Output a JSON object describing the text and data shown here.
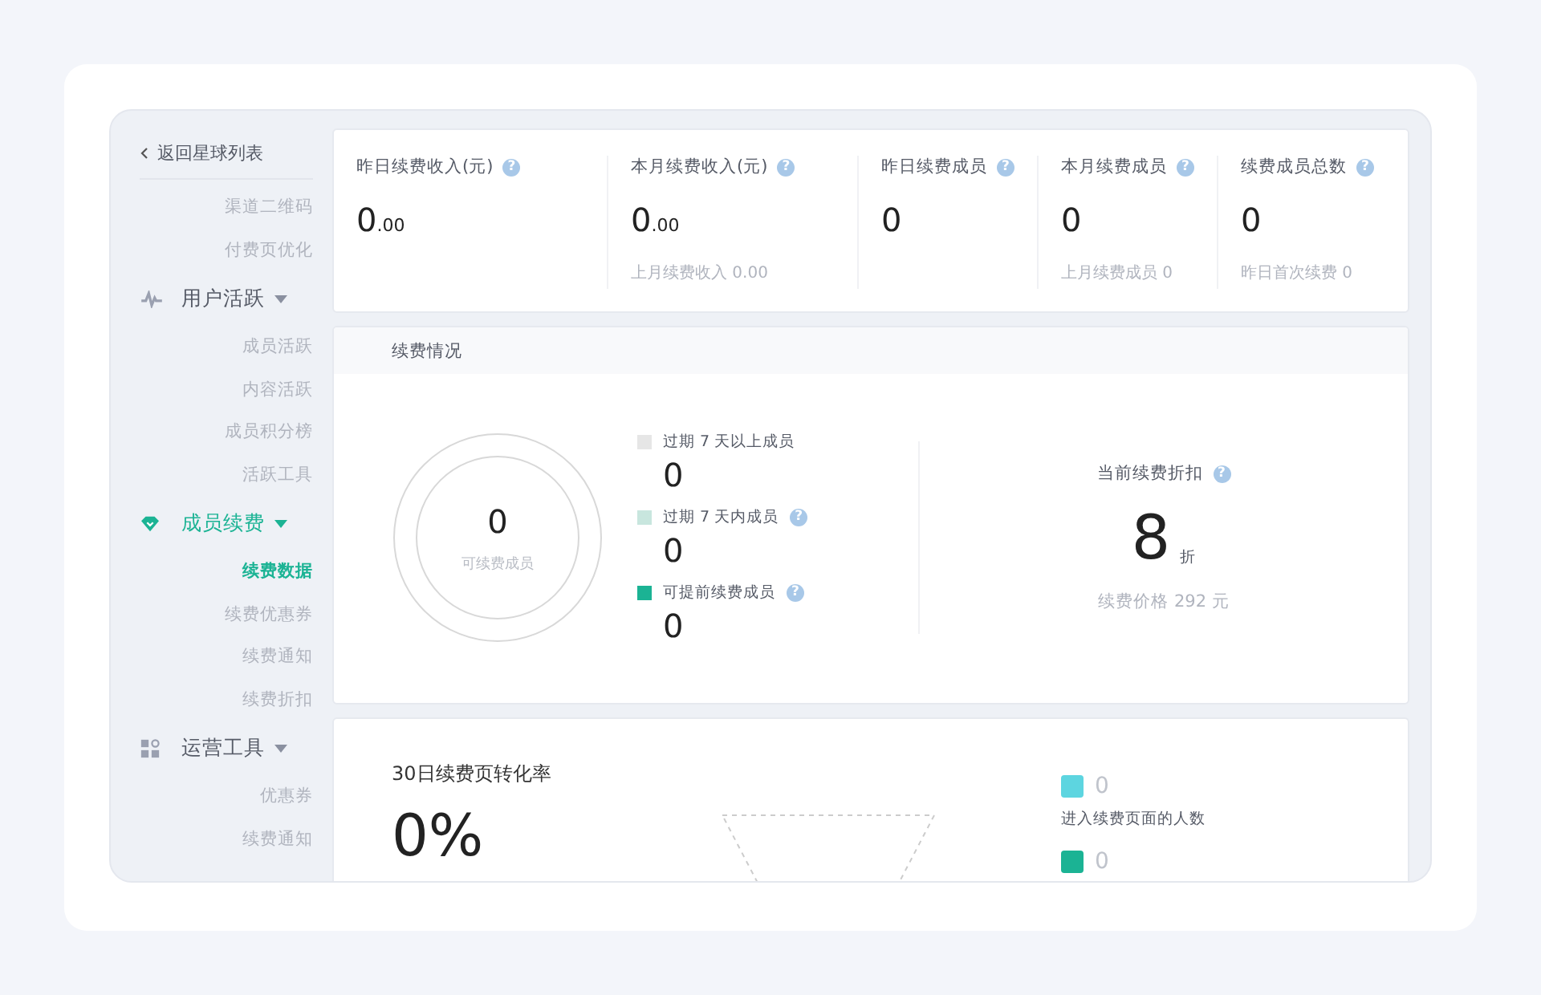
{
  "sidebar": {
    "back": "返回星球列表",
    "groups": [
      {
        "items": [
          {
            "label": "渠道二维码",
            "selected": false
          },
          {
            "label": "付费页优化",
            "selected": false
          }
        ]
      },
      {
        "title": "用户活跃",
        "selected": false,
        "expanded": true,
        "items": [
          {
            "label": "成员活跃",
            "selected": false
          },
          {
            "label": "内容活跃",
            "selected": false
          },
          {
            "label": "成员积分榜",
            "selected": false
          },
          {
            "label": "活跃工具",
            "selected": false
          }
        ]
      },
      {
        "title": "成员续费",
        "selected": true,
        "expanded": true,
        "items": [
          {
            "label": "续费数据",
            "selected": true
          },
          {
            "label": "续费优惠券",
            "selected": false
          },
          {
            "label": "续费通知",
            "selected": false
          },
          {
            "label": "续费折扣",
            "selected": false
          }
        ]
      },
      {
        "title": "运营工具",
        "selected": false,
        "expanded": true,
        "items": [
          {
            "label": "优惠券",
            "selected": false
          },
          {
            "label": "续费通知",
            "selected": false
          }
        ]
      }
    ]
  },
  "stats": [
    {
      "label": "昨日续费收入(元)",
      "help": "?",
      "value": "0",
      "decimals": ".00"
    },
    {
      "label": "本月续费收入(元)",
      "help": "?",
      "value": "0",
      "decimals": ".00",
      "sub": "上月续费收入 0.00"
    },
    {
      "label": "昨日续费成员",
      "help": "?",
      "value": "0"
    },
    {
      "label": "本月续费成员",
      "help": "?",
      "value": "0",
      "sub": "上月续费成员 0"
    },
    {
      "label": "续费成员总数",
      "help": "?",
      "value": "0",
      "sub": "昨日首次续费 0"
    }
  ],
  "renewal": {
    "title": "续费情况",
    "total": "0",
    "total_label": "可续费成员",
    "legend": [
      {
        "label": "过期 7 天以上成员",
        "value": "0",
        "color": "#e6e6e6"
      },
      {
        "label": "过期 7 天内成员",
        "value": "0",
        "color": "#c8e6de",
        "help": "?"
      },
      {
        "label": "可提前续费成员",
        "value": "0",
        "color": "#1bb394",
        "help": "?"
      }
    ],
    "discount": {
      "label": "当前续费折扣",
      "help": "?",
      "value": "8",
      "unit": "折",
      "price": "续费价格 292 元"
    }
  },
  "conversion": {
    "title": "30日续费页转化率",
    "rate": "0%",
    "legend": [
      {
        "value": "0",
        "color": "#5dd5e0",
        "label": "进入续费页面的人数"
      },
      {
        "value": "0",
        "color": "#1bb394"
      }
    ]
  }
}
